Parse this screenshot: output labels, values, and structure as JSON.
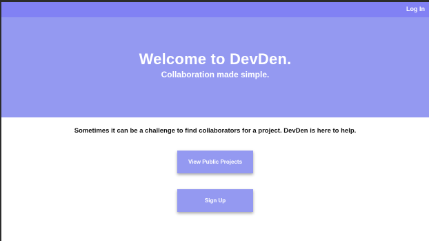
{
  "nav": {
    "login_label": "Log In"
  },
  "hero": {
    "title": "Welcome to DevDen.",
    "subtitle": "Collaboration made simple."
  },
  "main": {
    "intro": "Sometimes it can be a challenge to find collaborators for a project. DevDen is here to help.",
    "view_projects_label": "View Public Projects",
    "signup_label": "Sign Up"
  },
  "colors": {
    "topbar": "#8181f4",
    "hero": "#9499f1",
    "button": "#9499f1"
  }
}
